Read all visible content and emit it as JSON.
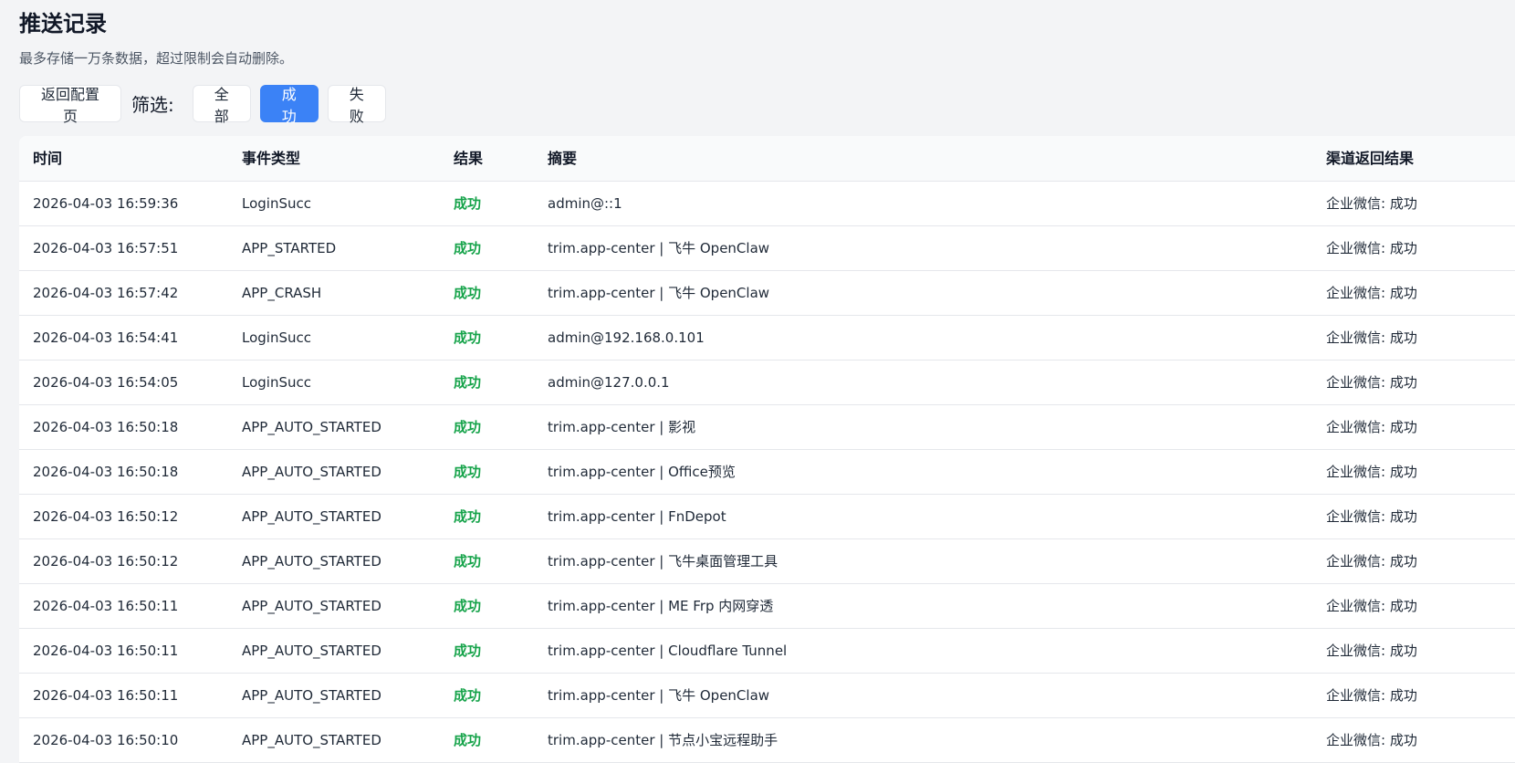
{
  "page": {
    "title": "推送记录",
    "subtitle": "最多存储一万条数据，超过限制会自动删除。"
  },
  "toolbar": {
    "back_label": "返回配置页",
    "filter_label": "筛选:",
    "filters": [
      {
        "label": "全部",
        "active": false
      },
      {
        "label": "成功",
        "active": true
      },
      {
        "label": "失败",
        "active": false
      }
    ]
  },
  "colors": {
    "accent": "#3b82f6",
    "success": "#16a34a",
    "background": "#f3f4f6"
  },
  "table": {
    "headers": [
      "时间",
      "事件类型",
      "结果",
      "摘要",
      "渠道返回结果"
    ],
    "rows": [
      {
        "time": "2026-04-03 16:59:36",
        "type": "LoginSucc",
        "result": "成功",
        "summary": "admin@::1",
        "channel": "企业微信: 成功"
      },
      {
        "time": "2026-04-03 16:57:51",
        "type": "APP_STARTED",
        "result": "成功",
        "summary": "trim.app-center | 飞牛 OpenClaw",
        "channel": "企业微信: 成功"
      },
      {
        "time": "2026-04-03 16:57:42",
        "type": "APP_CRASH",
        "result": "成功",
        "summary": "trim.app-center | 飞牛 OpenClaw",
        "channel": "企业微信: 成功"
      },
      {
        "time": "2026-04-03 16:54:41",
        "type": "LoginSucc",
        "result": "成功",
        "summary": "admin@192.168.0.101",
        "channel": "企业微信: 成功"
      },
      {
        "time": "2026-04-03 16:54:05",
        "type": "LoginSucc",
        "result": "成功",
        "summary": "admin@127.0.0.1",
        "channel": "企业微信: 成功"
      },
      {
        "time": "2026-04-03 16:50:18",
        "type": "APP_AUTO_STARTED",
        "result": "成功",
        "summary": "trim.app-center | 影视",
        "channel": "企业微信: 成功"
      },
      {
        "time": "2026-04-03 16:50:18",
        "type": "APP_AUTO_STARTED",
        "result": "成功",
        "summary": "trim.app-center | Office预览",
        "channel": "企业微信: 成功"
      },
      {
        "time": "2026-04-03 16:50:12",
        "type": "APP_AUTO_STARTED",
        "result": "成功",
        "summary": "trim.app-center | FnDepot",
        "channel": "企业微信: 成功"
      },
      {
        "time": "2026-04-03 16:50:12",
        "type": "APP_AUTO_STARTED",
        "result": "成功",
        "summary": "trim.app-center | 飞牛桌面管理工具",
        "channel": "企业微信: 成功"
      },
      {
        "time": "2026-04-03 16:50:11",
        "type": "APP_AUTO_STARTED",
        "result": "成功",
        "summary": "trim.app-center | ME Frp 内网穿透",
        "channel": "企业微信: 成功"
      },
      {
        "time": "2026-04-03 16:50:11",
        "type": "APP_AUTO_STARTED",
        "result": "成功",
        "summary": "trim.app-center | Cloudflare Tunnel",
        "channel": "企业微信: 成功"
      },
      {
        "time": "2026-04-03 16:50:11",
        "type": "APP_AUTO_STARTED",
        "result": "成功",
        "summary": "trim.app-center | 飞牛 OpenClaw",
        "channel": "企业微信: 成功"
      },
      {
        "time": "2026-04-03 16:50:10",
        "type": "APP_AUTO_STARTED",
        "result": "成功",
        "summary": "trim.app-center | 节点小宝远程助手",
        "channel": "企业微信: 成功"
      }
    ]
  }
}
